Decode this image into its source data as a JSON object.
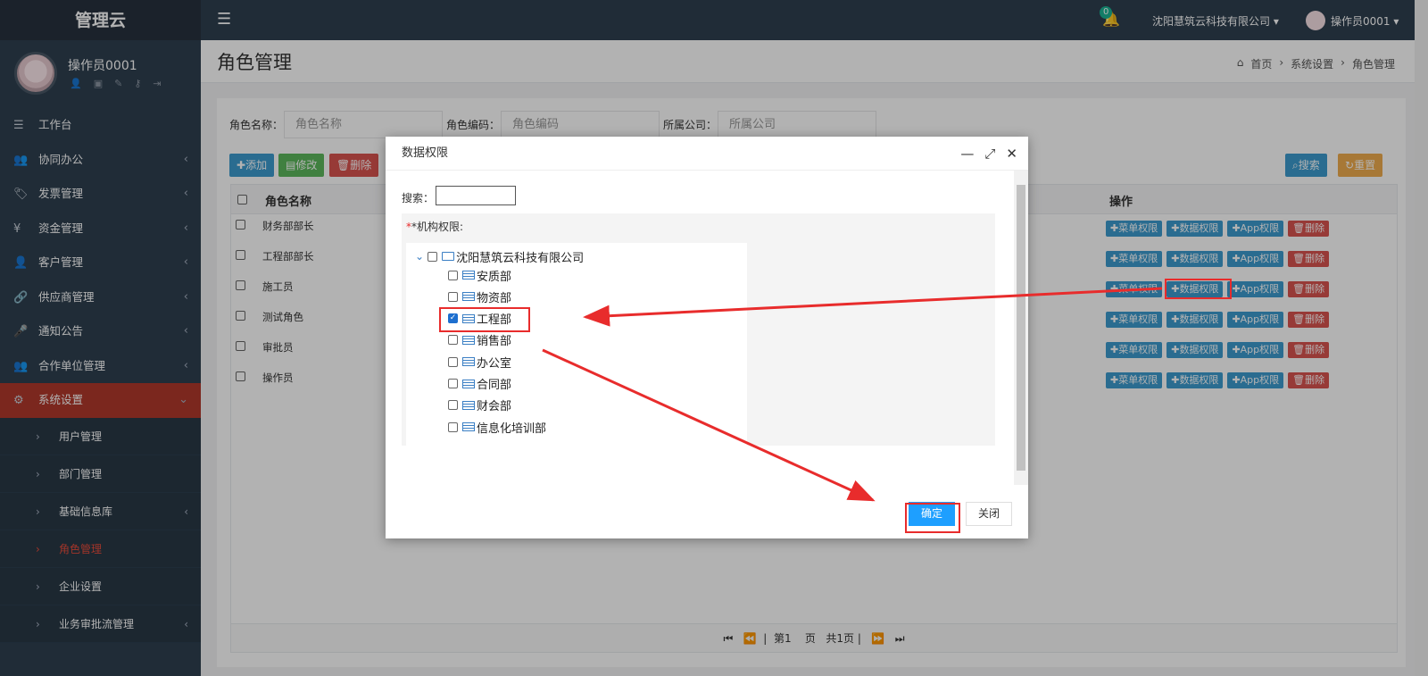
{
  "brand": "管理云",
  "profile": {
    "name": "操作员0001"
  },
  "sidebar": {
    "items": [
      {
        "icon": "☰",
        "label": "工作台"
      },
      {
        "icon": "👥",
        "label": "协同办公"
      },
      {
        "icon": "🏷",
        "label": "发票管理"
      },
      {
        "icon": "¥",
        "label": "资金管理"
      },
      {
        "icon": "👤",
        "label": "客户管理"
      },
      {
        "icon": "🔗",
        "label": "供应商管理"
      },
      {
        "icon": "🎤",
        "label": "通知公告"
      },
      {
        "icon": "👥",
        "label": "合作单位管理"
      },
      {
        "icon": "⚙",
        "label": "系统设置"
      }
    ],
    "sub": [
      {
        "label": "用户管理"
      },
      {
        "label": "部门管理"
      },
      {
        "label": "基础信息库"
      },
      {
        "label": "角色管理"
      },
      {
        "label": "企业设置"
      },
      {
        "label": "业务审批流管理"
      }
    ]
  },
  "topbar": {
    "bell_count": "0",
    "company": "沈阳慧筑云科技有限公司",
    "user": "操作员0001"
  },
  "page": {
    "title": "角色管理",
    "crumbs": [
      "首页",
      "系统设置",
      "角色管理"
    ]
  },
  "filters": {
    "role_name_label": "角色名称：",
    "role_name_placeholder": "角色名称",
    "role_code_label": "角色编码：",
    "role_code_placeholder": "角色编码",
    "company_label": "所属公司：",
    "company_placeholder": "所属公司"
  },
  "toolbar": {
    "add": "添加",
    "edit": "修改",
    "delete": "删除",
    "search": "搜索",
    "reset": "重置"
  },
  "table": {
    "col_name": "角色名称",
    "col_ops": "操作",
    "rows": [
      "财务部部长",
      "工程部部长",
      "施工员",
      "测试角色",
      "审批员",
      "操作员"
    ],
    "ops": {
      "menu": "菜单权限",
      "data": "数据权限",
      "app": "App权限",
      "del": "删除"
    }
  },
  "pager": {
    "page_prefix": "第",
    "page_num": "1",
    "page_suffix": "页",
    "total": "共1页"
  },
  "modal": {
    "title": "数据权限",
    "search_label": "搜索：",
    "perm_label": "*机构权限:",
    "root": "沈阳慧筑云科技有限公司",
    "depts": [
      {
        "label": "安质部",
        "checked": false
      },
      {
        "label": "物资部",
        "checked": false
      },
      {
        "label": "工程部",
        "checked": true
      },
      {
        "label": "销售部",
        "checked": false
      },
      {
        "label": "办公室",
        "checked": false
      },
      {
        "label": "合同部",
        "checked": false
      },
      {
        "label": "财会部",
        "checked": false
      },
      {
        "label": "信息化培训部",
        "checked": false
      }
    ],
    "ok": "确定",
    "close": "关闭"
  },
  "colors": {
    "sidebar": "#2f4050",
    "active": "#b0392b",
    "primary": "#1e9fff",
    "annotation": "#e82c2c"
  }
}
